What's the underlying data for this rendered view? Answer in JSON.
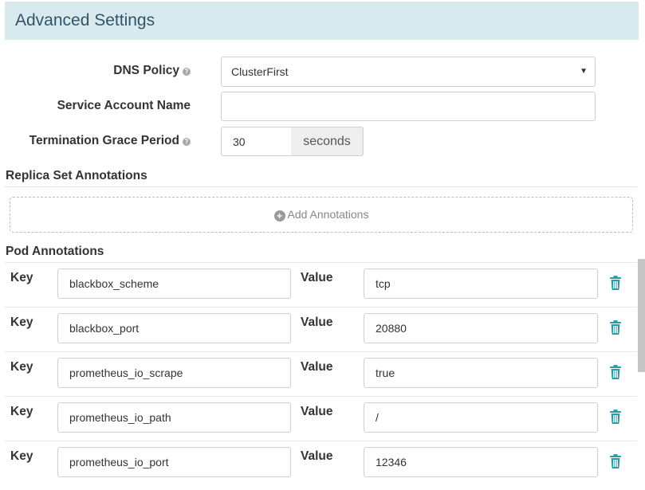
{
  "section": {
    "title": "Advanced Settings"
  },
  "dns_policy": {
    "label": "DNS Policy",
    "selected": "ClusterFirst"
  },
  "service_account": {
    "label": "Service Account Name",
    "value": ""
  },
  "termination": {
    "label": "Termination Grace Period",
    "value": "30",
    "unit": "seconds"
  },
  "replica_set_annotations": {
    "title": "Replica Set Annotations",
    "add_label": "Add Annotations"
  },
  "pod_annotations": {
    "title": "Pod Annotations",
    "key_label": "Key",
    "value_label": "Value",
    "rows": [
      {
        "key": "blackbox_scheme",
        "value": "tcp"
      },
      {
        "key": "blackbox_port",
        "value": "20880"
      },
      {
        "key": "prometheus_io_scrape",
        "value": "true"
      },
      {
        "key": "prometheus_io_path",
        "value": "/"
      },
      {
        "key": "prometheus_io_port",
        "value": "12346"
      }
    ]
  },
  "colors": {
    "header_bg": "#d9eaee",
    "header_text": "#34536b",
    "trash_accent": "#2b9da6"
  },
  "icons": {
    "help": "question-circle-icon",
    "add": "plus-circle-icon",
    "delete": "trash-icon",
    "select": "caret-down-icon"
  }
}
